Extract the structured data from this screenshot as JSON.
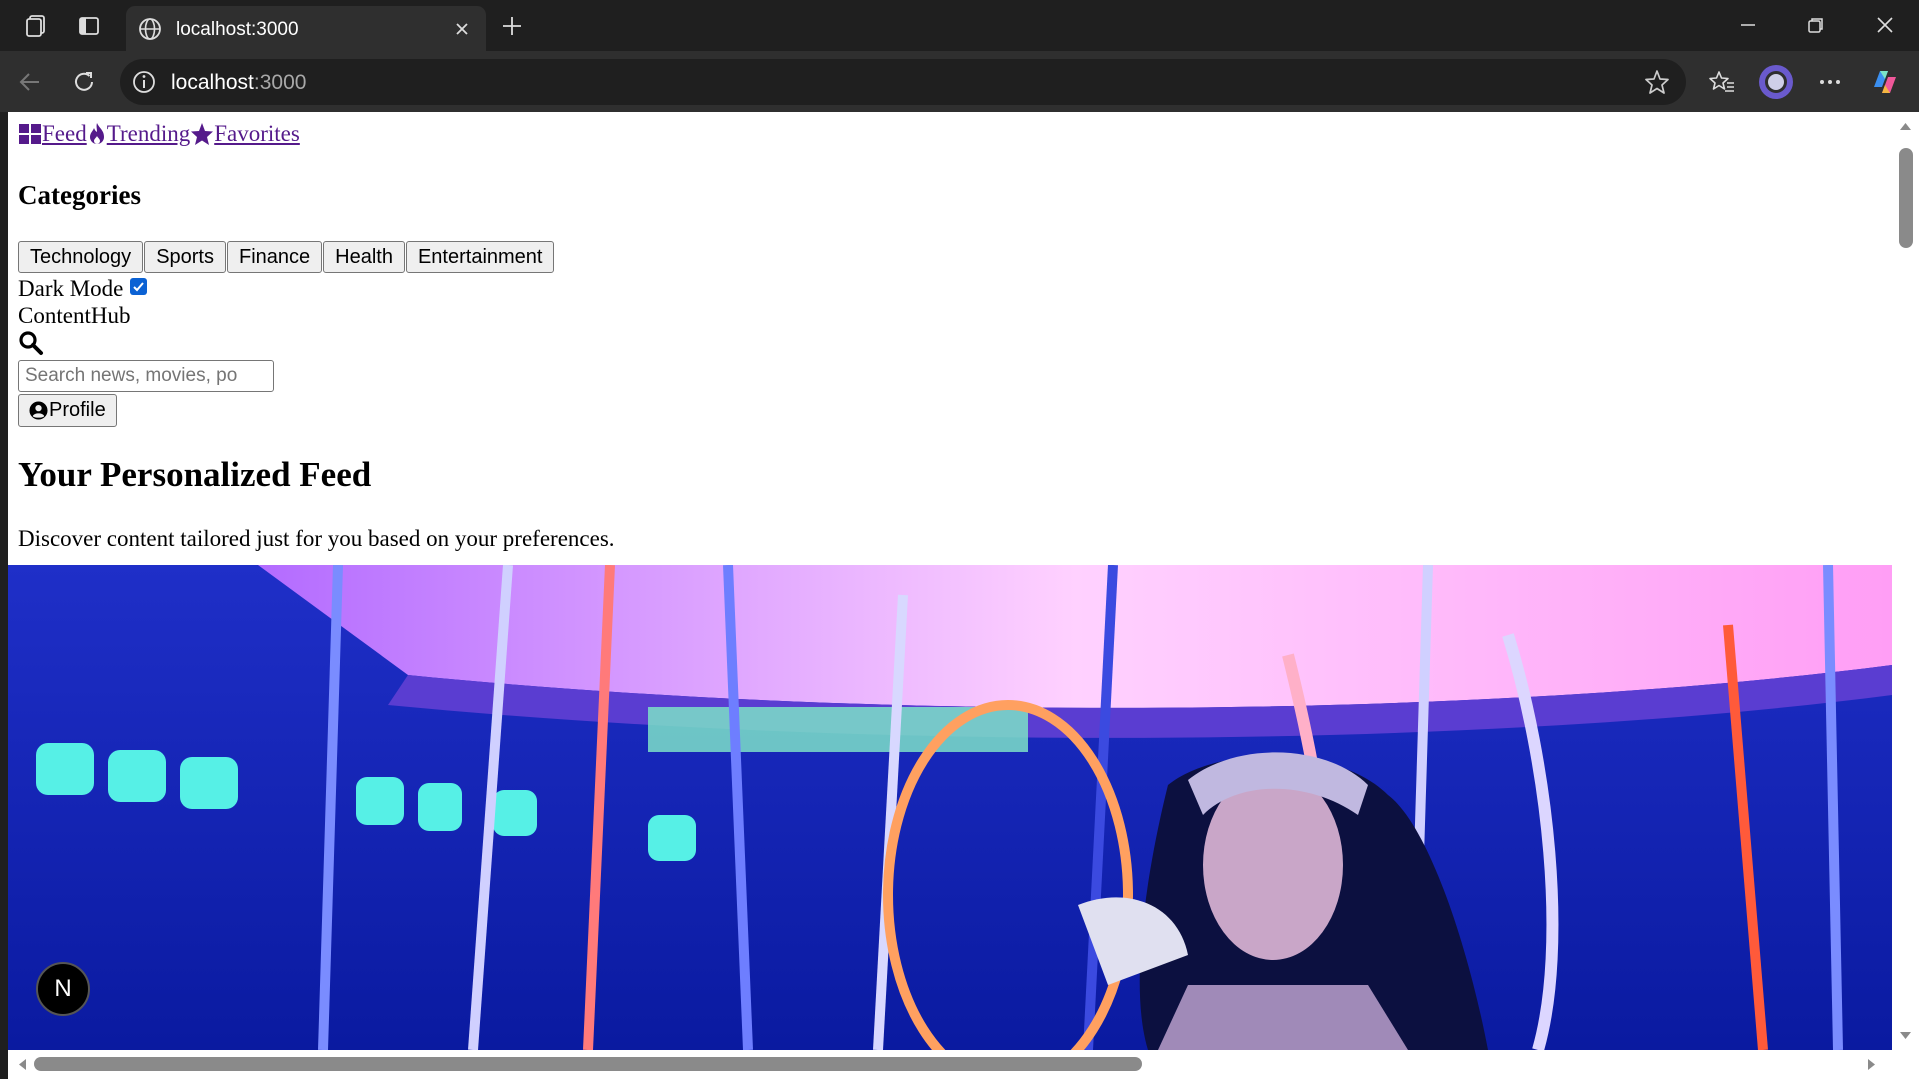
{
  "browser": {
    "tab_title": "localhost:3000",
    "address_host": "localhost",
    "address_port": ":3000"
  },
  "nav": {
    "feed": "Feed",
    "trending": "Trending",
    "favorites": "Favorites"
  },
  "categories": {
    "heading": "Categories",
    "items": [
      "Technology",
      "Sports",
      "Finance",
      "Health",
      "Entertainment"
    ]
  },
  "dark_mode": {
    "label": "Dark Mode",
    "checked": true
  },
  "brand": "ContentHub",
  "search": {
    "placeholder": "Search news, movies, po"
  },
  "profile": {
    "label": "Profile"
  },
  "feed": {
    "title": "Your Personalized Feed",
    "description": "Discover content tailored just for you based on your preferences."
  },
  "dev_badge": "N",
  "colors": {
    "link": "#551a8b",
    "checkbox": "#0b62d4",
    "chrome_dark": "#1f1f1f",
    "chrome_mid": "#2f2f2f"
  }
}
